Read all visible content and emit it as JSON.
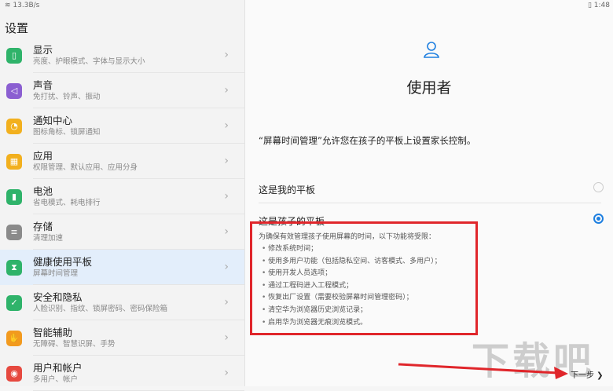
{
  "status": {
    "left": "13.3B/s",
    "right": "1:48"
  },
  "settings_title": "设置",
  "menu": [
    {
      "label": "显示",
      "sub": "亮度、护眼模式、字体与显示大小",
      "color": "#2fb36a",
      "icon": "display-icon",
      "glyph": "▯"
    },
    {
      "label": "声音",
      "sub": "免打扰、铃声、振动",
      "color": "#8b5fd1",
      "icon": "speaker-icon",
      "glyph": "◁"
    },
    {
      "label": "通知中心",
      "sub": "图标角标、锁屏通知",
      "color": "#f2b01e",
      "icon": "bell-icon",
      "glyph": "◔"
    },
    {
      "label": "应用",
      "sub": "权限管理、默认应用、应用分身",
      "color": "#f2b01e",
      "icon": "apps-grid-icon",
      "glyph": "▦"
    },
    {
      "label": "电池",
      "sub": "省电模式、耗电排行",
      "color": "#2fb36a",
      "icon": "battery-icon",
      "glyph": "▮"
    },
    {
      "label": "存储",
      "sub": "清理加速",
      "color": "#8a8a8a",
      "icon": "storage-icon",
      "glyph": "≡"
    },
    {
      "label": "健康使用平板",
      "sub": "屏幕时间管理",
      "color": "#2fb36a",
      "icon": "hourglass-icon",
      "glyph": "⧗"
    },
    {
      "label": "安全和隐私",
      "sub": "人脸识别、指纹、锁屏密码、密码保险箱",
      "color": "#2fb36a",
      "icon": "shield-icon",
      "glyph": "✓"
    },
    {
      "label": "智能辅助",
      "sub": "无障碍、智慧识屏、手势",
      "color": "#f29a1e",
      "icon": "hand-icon",
      "glyph": "✋"
    },
    {
      "label": "用户和帐户",
      "sub": "多用户、帐户",
      "color": "#e6493f",
      "icon": "user-account-icon",
      "glyph": "◉"
    }
  ],
  "active_index": 6,
  "panel": {
    "heading": "使用者",
    "description": "“屏幕时间管理”允许您在孩子的平板上设置家长控制。",
    "option_mine": "这是我的平板",
    "option_child": "这是孩子的平板",
    "restriction_intro": "为确保有效管理孩子使用屏幕的时间，以下功能将受限：",
    "restrictions": [
      "修改系统时间；",
      "使用多用户功能（包括隐私空间、访客模式、多用户）；",
      "使用开发人员选项；",
      "通过工程码进入工程模式；",
      "恢复出厂设置（需要校验屏幕时间管理密码）；",
      "清空华为浏览器历史浏览记录；",
      "启用华为浏览器无痕浏览模式。"
    ],
    "next_label": "下一步 ❯"
  },
  "watermark": "下载吧",
  "colors": {
    "accent": "#1e7fe0",
    "highlight_box": "#e0262b",
    "arrow": "#e0262b"
  }
}
